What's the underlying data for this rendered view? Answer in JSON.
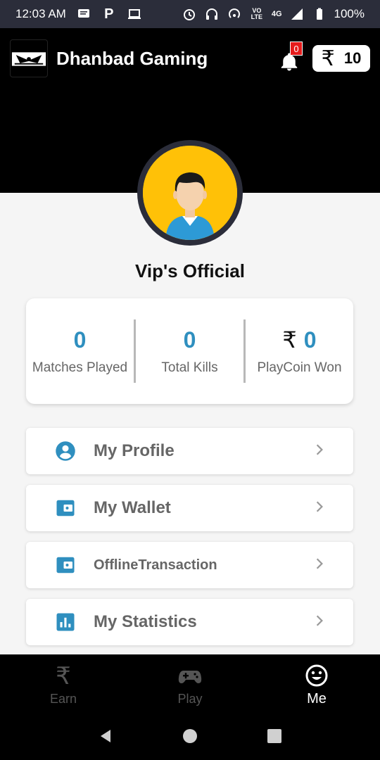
{
  "status_bar": {
    "time": "12:03 AM",
    "network": "4G",
    "battery": "100%"
  },
  "header": {
    "app_title": "Dhanbad Gaming",
    "notification_count": "0",
    "wallet_symbol": "₹",
    "wallet_balance": "10"
  },
  "profile": {
    "name": "Vip's Official"
  },
  "stats": [
    {
      "value": "0",
      "label": "Matches Played"
    },
    {
      "value": "0",
      "label": "Total Kills"
    },
    {
      "symbol": "₹",
      "value": "0",
      "label": "PlayCoin Won"
    }
  ],
  "menu": [
    {
      "label": "My Profile",
      "icon": "account-circle-icon"
    },
    {
      "label": "My Wallet",
      "icon": "wallet-icon"
    },
    {
      "label": "OfflineTransaction",
      "icon": "wallet-icon"
    },
    {
      "label": "My Statistics",
      "icon": "bar-chart-icon"
    }
  ],
  "bottom_nav": [
    {
      "label": "Earn",
      "icon": "rupee-icon",
      "active": false
    },
    {
      "label": "Play",
      "icon": "gamepad-icon",
      "active": false
    },
    {
      "label": "Me",
      "icon": "smiley-icon",
      "active": true
    }
  ],
  "colors": {
    "accent": "#2f8fbf",
    "avatar_bg": "#ffc107",
    "header_bg": "#000000",
    "status_bar_bg": "#2b2d3a",
    "badge": "#e51b1b"
  }
}
